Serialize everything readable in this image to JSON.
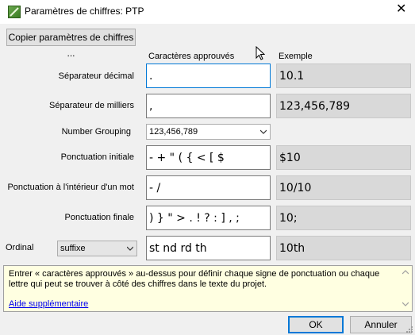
{
  "window": {
    "title": "Paramètres de chiffres: PTP",
    "close_glyph": "✕"
  },
  "toolbar": {
    "copy_button": "Copier paramètres de chiffres ..."
  },
  "columns": {
    "approved": "Caractères approuvés",
    "example": "Exemple"
  },
  "rows": {
    "decimal": {
      "label": "Séparateur décimal",
      "value": ".",
      "example": "10.1"
    },
    "thousands": {
      "label": "Séparateur de milliers",
      "value": ",",
      "example": "123,456,789"
    },
    "grouping": {
      "label": "Number Grouping",
      "selected": "123,456,789"
    },
    "initial": {
      "label": "Ponctuation initiale",
      "value": "- + \" ( { < [ $",
      "example": "$10"
    },
    "medial": {
      "label": "Ponctuation à l'intérieur d'un mot",
      "value": "- /",
      "example": "10/10"
    },
    "final": {
      "label": "Ponctuation finale",
      "value": ") } \" > . ! ? : ] , ;",
      "example": "10;"
    },
    "ordinal": {
      "label": "Ordinal",
      "mode": "suffixe",
      "value": "st nd rd th",
      "example": "10th"
    }
  },
  "info": {
    "text": "Entrer « caractères approuvés » au-dessus pour définir chaque signe de ponctuation ou chaque lettre qui peut se trouver à côté des chiffres dans le texte du projet.",
    "link": "Aide supplémentaire"
  },
  "buttons": {
    "ok": "OK",
    "cancel": "Annuler"
  },
  "colors": {
    "focus_border": "#0078d7",
    "info_background": "#ffffe1",
    "link": "#0000ee",
    "example_background": "#d9d9d9"
  },
  "icons": [
    "app-icon",
    "close-icon",
    "chevron-down-icon",
    "scroll-up-icon",
    "scroll-down-icon",
    "mouse-cursor-icon",
    "resize-grip-icon"
  ]
}
